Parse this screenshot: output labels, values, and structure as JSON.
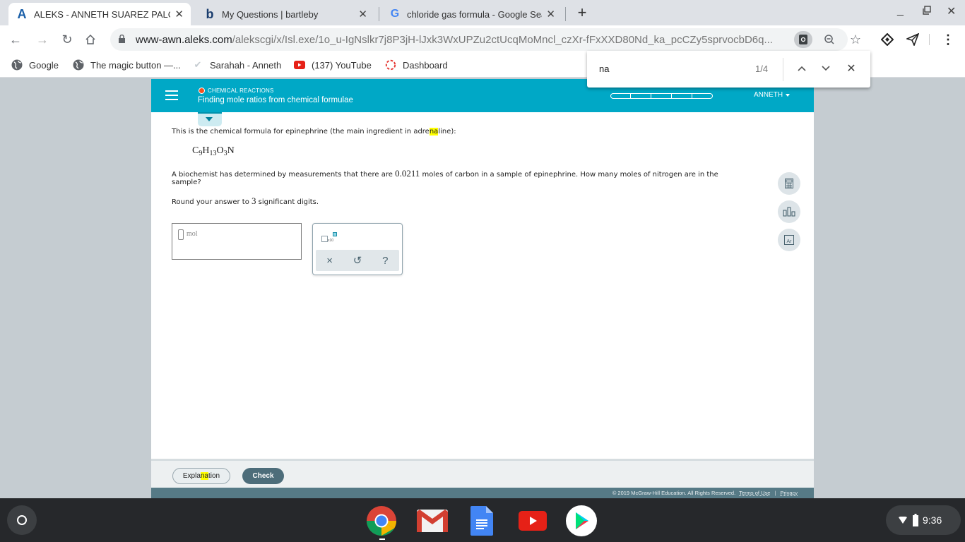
{
  "browser": {
    "tabs": [
      {
        "label": "ALEKS - ANNETH SUAREZ PALOMINO",
        "favicon": "aleks-A",
        "active": true
      },
      {
        "label": "My Questions | bartleby",
        "favicon": "bartleby-b",
        "active": false
      },
      {
        "label": "chloride gas formula - Google Search",
        "favicon": "google-G",
        "active": false
      }
    ],
    "url_host": "www-awn.aleks.com",
    "url_path": "/alekscgi/x/Isl.exe/1o_u-IgNslkr7j8P3jH-lJxk3WxUPZu2ctUcqMoMncl_czXr-fFxXXD80Nd_ka_pcCZy5sprvocbD6q...",
    "bookmarks": [
      {
        "label": "Google",
        "icon": "globe-icon"
      },
      {
        "label": "The magic button —...",
        "icon": "globe-icon"
      },
      {
        "label": "Sarahah - Anneth",
        "icon": "check-icon"
      },
      {
        "label": "(137) YouTube",
        "icon": "youtube-icon"
      },
      {
        "label": "Dashboard",
        "icon": "dashboard-icon"
      }
    ],
    "find": {
      "query": "na",
      "count": "1/4"
    }
  },
  "aleks": {
    "category": "CHEMICAL REACTIONS",
    "topic": "Finding mole ratios from chemical formulae",
    "user": "ANNETH",
    "progress": {
      "segments": 5,
      "filled": 0
    },
    "question": {
      "intro_before": "This is the chemical formula for epinephrine (the main ingredient in adre",
      "intro_highlight": "na",
      "intro_after": "line):",
      "formula": {
        "C": "9",
        "H": "13",
        "O": "3",
        "N": ""
      },
      "body_before": "A biochemist has determined by measurements that there are ",
      "moles_carbon": "0.0211",
      "body_after": "  moles of carbon in a sample of epinephrine. How many moles of nitrogen are in the",
      "body_line2": "sample?",
      "round_before": "Round your answer to ",
      "sig_digits": "3",
      "round_after": " significant digits."
    },
    "answer": {
      "value": "",
      "unit": "mol"
    },
    "tool_panel": {
      "x10_label": "x10",
      "clear": "×",
      "undo": "↺",
      "help": "?"
    },
    "side_tools": [
      "calculator-icon",
      "data-chart-icon",
      "periodic-table-icon"
    ],
    "periodic_label": "Ar",
    "buttons": {
      "explanation_before": "Expla",
      "explanation_highlight": "na",
      "explanation_after": "tion",
      "check": "Check"
    },
    "footer": {
      "copyright": "© 2019 McGraw-Hill Education. All Rights Reserved.",
      "terms": "Terms of Use",
      "privacy": "Privacy"
    }
  },
  "shelf": {
    "apps": [
      "chrome-icon",
      "gmail-icon",
      "docs-icon",
      "youtube-icon",
      "play-store-icon"
    ],
    "time": "9:36"
  }
}
